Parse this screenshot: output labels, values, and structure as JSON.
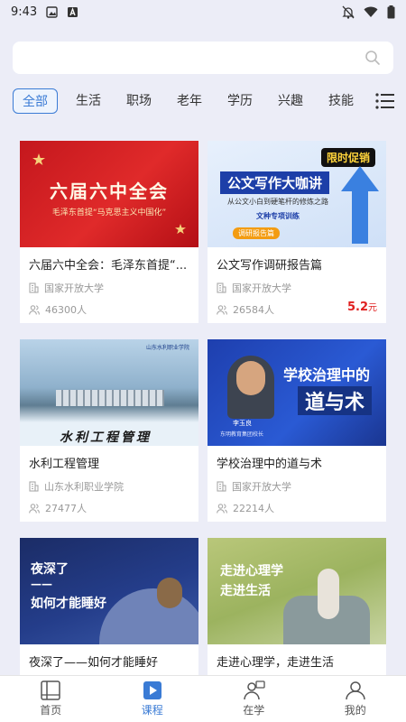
{
  "status": {
    "time": "9:43"
  },
  "search": {
    "placeholder": ""
  },
  "categories": [
    "全部",
    "生活",
    "职场",
    "老年",
    "学历",
    "兴趣",
    "技能"
  ],
  "courses": [
    {
      "title": "六届六中全会：毛泽东首提“...",
      "org": "国家开放大学",
      "learners": "46300人",
      "price": "",
      "cover_text": "六届六中全会",
      "cover_sub": "毛泽东首提“马克思主义中国化”"
    },
    {
      "title": "公文写作调研报告篇",
      "org": "国家开放大学",
      "learners": "26584人",
      "price": "5.2",
      "price_unit": "元",
      "cover_text": "公文写作大咖讲",
      "cover_sub": "从公文小白到硬笔杆的修炼之路",
      "cover_badge": "限时促销",
      "cover_tag": "文种专项训练",
      "cover_tag2": "调研报告篇"
    },
    {
      "title": "水利工程管理",
      "org": "山东水利职业学院",
      "learners": "27477人",
      "price": "",
      "cover_text": "水利工程管理",
      "cover_sub": "山东水利职业学院"
    },
    {
      "title": "学校治理中的道与术",
      "org": "国家开放大学",
      "learners": "22214人",
      "price": "",
      "cover_text": "学校治理中的",
      "cover_text2": "道与术",
      "cover_sub": "李玉良",
      "cover_sub2": "东明教育集团校长"
    },
    {
      "title": "夜深了——如何才能睡好",
      "org": "",
      "learners": "",
      "price": "",
      "cover_text": "夜深了",
      "cover_text2": "——",
      "cover_text3": "如何才能睡好"
    },
    {
      "title": "走进心理学，走进生活",
      "org": "",
      "learners": "",
      "price": "",
      "cover_text": "走进心理学",
      "cover_text2": "走进生活"
    }
  ],
  "nav": [
    {
      "label": "首页",
      "icon": "book-icon"
    },
    {
      "label": "课程",
      "icon": "play-icon",
      "active": true
    },
    {
      "label": "在学",
      "icon": "study-icon"
    },
    {
      "label": "我的",
      "icon": "user-icon"
    }
  ],
  "colors": {
    "accent": "#3a7bd5",
    "price": "#e02020",
    "background": "#ecedf7"
  }
}
